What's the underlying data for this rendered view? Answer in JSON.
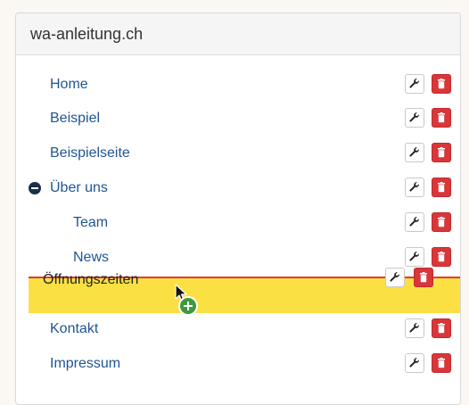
{
  "panel": {
    "title": "wa-anleitung.ch"
  },
  "menu": {
    "items": [
      {
        "label": "Home"
      },
      {
        "label": "Beispiel"
      },
      {
        "label": "Beispielseite"
      },
      {
        "label": "Über uns"
      },
      {
        "label": "Team"
      },
      {
        "label": "News"
      },
      {
        "label": "Kontakt"
      },
      {
        "label": "Impressum"
      }
    ],
    "dragging": {
      "label": "Öffnungszeiten"
    }
  },
  "icons": {
    "edit": "wrench-icon",
    "delete": "trash-icon",
    "collapse": "minus-circle-icon",
    "drop": "plus-circle-icon"
  },
  "colors": {
    "link": "#1f5592",
    "delete": "#d9363a",
    "dropzone": "#fbe044",
    "dropline": "#e53935",
    "drop_badge": "#3c9a3c"
  }
}
